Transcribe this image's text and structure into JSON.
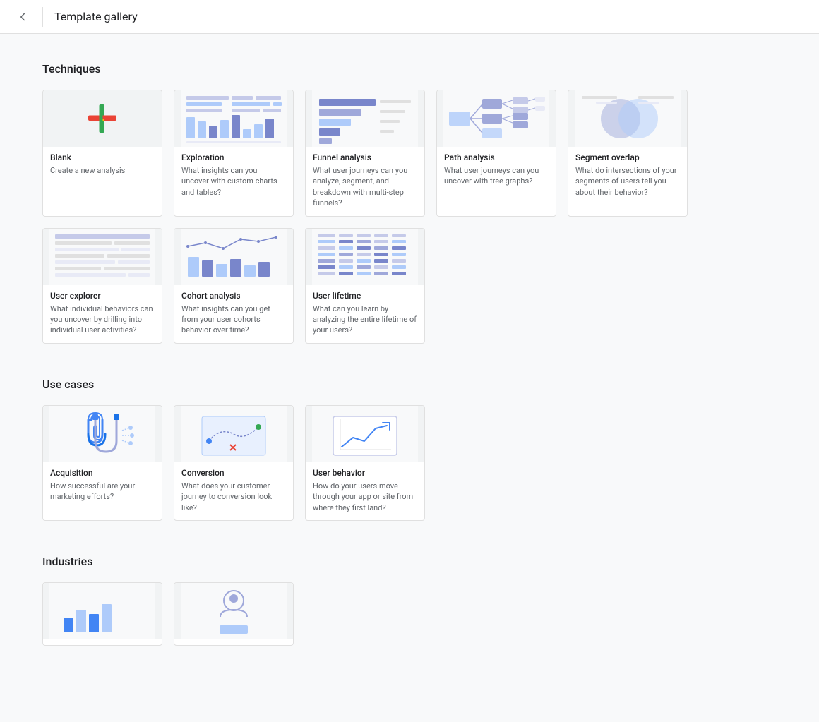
{
  "header": {
    "back_label": "←",
    "title": "Template gallery"
  },
  "techniques": {
    "section_title": "Techniques",
    "cards": [
      {
        "id": "blank",
        "name": "Blank",
        "desc": "Create a new analysis",
        "thumb_type": "blank"
      },
      {
        "id": "exploration",
        "name": "Exploration",
        "desc": "What insights can you uncover with custom charts and tables?",
        "thumb_type": "exploration"
      },
      {
        "id": "funnel",
        "name": "Funnel analysis",
        "desc": "What user journeys can you analyze, segment, and breakdown with multi-step funnels?",
        "thumb_type": "funnel"
      },
      {
        "id": "path",
        "name": "Path analysis",
        "desc": "What user journeys can you uncover with tree graphs?",
        "thumb_type": "path"
      },
      {
        "id": "segment",
        "name": "Segment overlap",
        "desc": "What do intersections of your segments of users tell you about their behavior?",
        "thumb_type": "segment"
      },
      {
        "id": "user-explorer",
        "name": "User explorer",
        "desc": "What individual behaviors can you uncover by drilling into individual user activities?",
        "thumb_type": "user_explorer"
      },
      {
        "id": "cohort",
        "name": "Cohort analysis",
        "desc": "What insights can you get from your user cohorts behavior over time?",
        "thumb_type": "cohort"
      },
      {
        "id": "user-lifetime",
        "name": "User lifetime",
        "desc": "What can you learn by analyzing the entire lifetime of your users?",
        "thumb_type": "user_lifetime"
      }
    ]
  },
  "use_cases": {
    "section_title": "Use cases",
    "cards": [
      {
        "id": "acquisition",
        "name": "Acquisition",
        "desc": "How successful are your marketing efforts?",
        "thumb_type": "acquisition"
      },
      {
        "id": "conversion",
        "name": "Conversion",
        "desc": "What does your customer journey to conversion look like?",
        "thumb_type": "conversion"
      },
      {
        "id": "user-behavior",
        "name": "User behavior",
        "desc": "How do your users move through your app or site from where they first land?",
        "thumb_type": "user_behavior"
      }
    ]
  },
  "industries": {
    "section_title": "Industries",
    "cards": [
      {
        "id": "industry-1",
        "name": "",
        "desc": "",
        "thumb_type": "industry1"
      },
      {
        "id": "industry-2",
        "name": "",
        "desc": "",
        "thumb_type": "industry2"
      }
    ]
  }
}
